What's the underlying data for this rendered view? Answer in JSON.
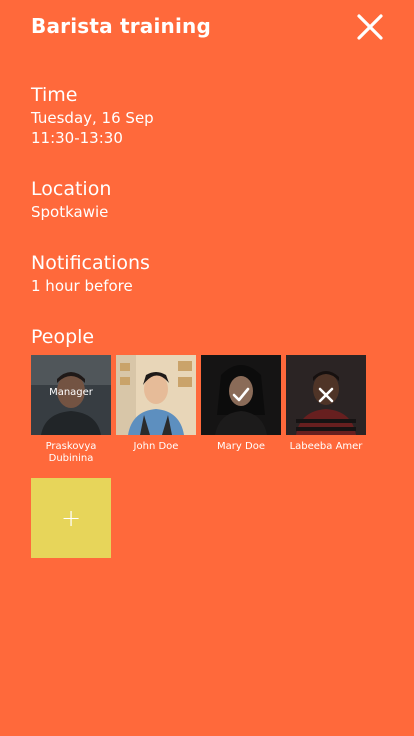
{
  "header": {
    "title": "Barista training",
    "close_icon": "close-icon"
  },
  "time": {
    "heading": "Time",
    "date": "Tuesday, 16 Sep",
    "range": "11:30-13:30"
  },
  "location": {
    "heading": "Location",
    "value": "Spotkawie"
  },
  "notifications": {
    "heading": "Notifications",
    "value": "1 hour before"
  },
  "people": {
    "heading": "People",
    "members": [
      {
        "name": "Praskovya Dubinina",
        "badge": "Manager",
        "status_icon": ""
      },
      {
        "name": "John Doe",
        "badge": "",
        "status_icon": ""
      },
      {
        "name": "Mary Doe",
        "badge": "",
        "status_icon": "check-icon"
      },
      {
        "name": "Labeeba Amer",
        "badge": "",
        "status_icon": "cross-icon"
      }
    ],
    "add_label": "+"
  },
  "colors": {
    "background": "#FF693B",
    "add_button": "#E7D55A",
    "text": "#FFFFFF"
  }
}
